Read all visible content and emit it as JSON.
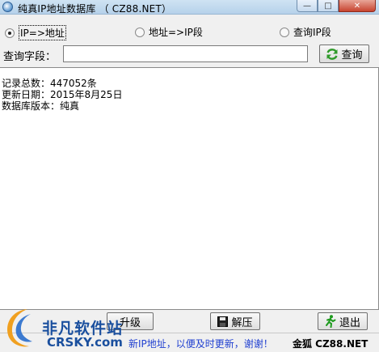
{
  "window": {
    "title": "纯真IP地址数据库 （ CZ88.NET）"
  },
  "modes": [
    {
      "label": "IP=>地址",
      "selected": true
    },
    {
      "label": "地址=>IP段",
      "selected": false
    },
    {
      "label": "查询IP段",
      "selected": false
    }
  ],
  "query": {
    "label": "查询字段：",
    "value": "",
    "button_label": "查询"
  },
  "result": {
    "lines": [
      "记录总数：447052条",
      "更新日期：2015年8月25日",
      "数据库版本：纯真"
    ]
  },
  "buttons": {
    "upgrade": "升级",
    "extract": "解压",
    "quit": "退出"
  },
  "status": {
    "message": "新IP地址，以便及时更新，谢谢！",
    "author": "金狐  CZ88.NET"
  },
  "watermark": {
    "cn": "非凡软件站",
    "en": "CRSKY.com"
  },
  "colors": {
    "status_text": "#1f3fd0",
    "watermark": "#1a4f9e",
    "close_button": "#c7432f"
  }
}
